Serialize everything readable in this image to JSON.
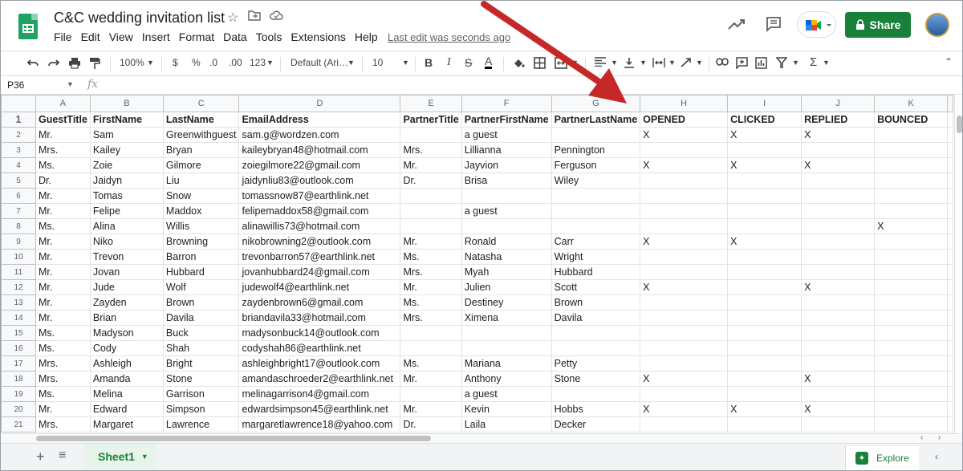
{
  "app": {
    "doc_title": "C&C wedding invitation list",
    "menu": [
      "File",
      "Edit",
      "View",
      "Insert",
      "Format",
      "Data",
      "Tools",
      "Extensions",
      "Help"
    ],
    "last_edit": "Last edit was seconds ago",
    "share_label": "Share",
    "brand_green": "#188038"
  },
  "toolbar": {
    "zoom": "100%",
    "currency": "$",
    "percent": "%",
    "decrease_decimal": ".0",
    "increase_decimal": ".00",
    "more_formats": "123",
    "font": "Default (Ari…",
    "font_size": "10",
    "bold": "B",
    "italic": "I",
    "strike": "S",
    "text_color": "A"
  },
  "formula_bar": {
    "cell_ref": "P36",
    "fx": "fx"
  },
  "sheet": {
    "columns": [
      "A",
      "B",
      "C",
      "D",
      "E",
      "F",
      "G",
      "H",
      "I",
      "J",
      "K"
    ],
    "rows": [
      [
        "GuestTitle",
        "FirstName",
        "LastName",
        "EmailAddress",
        "PartnerTitle",
        "PartnerFirstName",
        "PartnerLastName",
        "OPENED",
        "CLICKED",
        "REPLIED",
        "BOUNCED"
      ],
      [
        "Mr.",
        "Sam",
        "Greenwithguest",
        "sam.g@wordzen.com",
        "",
        "a guest",
        "",
        "X",
        "X",
        "X",
        ""
      ],
      [
        "Mrs.",
        "Kailey",
        "Bryan",
        "kaileybryan48@hotmail.com",
        "Mrs.",
        "Lillianna",
        "Pennington",
        "",
        "",
        "",
        ""
      ],
      [
        "Ms.",
        "Zoie",
        "Gilmore",
        "zoiegilmore22@gmail.com",
        "Mr.",
        "Jayvion",
        "Ferguson",
        "X",
        "X",
        "X",
        ""
      ],
      [
        "Dr.",
        "Jaidyn",
        "Liu",
        "jaidynliu83@outlook.com",
        "Dr.",
        "Brisa",
        "Wiley",
        "",
        "",
        "",
        ""
      ],
      [
        "Mr.",
        "Tomas",
        "Snow",
        "tomassnow87@earthlink.net",
        "",
        "",
        "",
        "",
        "",
        "",
        ""
      ],
      [
        "Mr.",
        "Felipe",
        "Maddox",
        "felipemaddox58@gmail.com",
        "",
        "a guest",
        "",
        "",
        "",
        "",
        ""
      ],
      [
        "Ms.",
        "Alina",
        "Willis",
        "alinawillis73@hotmail.com",
        "",
        "",
        "",
        "",
        "",
        "",
        "X"
      ],
      [
        "Mr.",
        "Niko",
        "Browning",
        "nikobrowning2@outlook.com",
        "Mr.",
        "Ronald",
        "Carr",
        "X",
        "X",
        "",
        ""
      ],
      [
        "Mr.",
        "Trevon",
        "Barron",
        "trevonbarron57@earthlink.net",
        "Ms.",
        "Natasha",
        "Wright",
        "",
        "",
        "",
        ""
      ],
      [
        "Mr.",
        "Jovan",
        "Hubbard",
        "jovanhubbard24@gmail.com",
        "Mrs.",
        "Myah",
        "Hubbard",
        "",
        "",
        "",
        ""
      ],
      [
        "Mr.",
        "Jude",
        "Wolf",
        "judewolf4@earthlink.net",
        "Mr.",
        "Julien",
        "Scott",
        "X",
        "",
        "X",
        ""
      ],
      [
        "Mr.",
        "Zayden",
        "Brown",
        "zaydenbrown6@gmail.com",
        "Ms.",
        "Destiney",
        "Brown",
        "",
        "",
        "",
        ""
      ],
      [
        "Mr.",
        "Brian",
        "Davila",
        "briandavila33@hotmail.com",
        "Mrs.",
        "Ximena",
        "Davila",
        "",
        "",
        "",
        ""
      ],
      [
        "Ms.",
        "Madyson",
        "Buck",
        "madysonbuck14@outlook.com",
        "",
        "",
        "",
        "",
        "",
        "",
        ""
      ],
      [
        "Ms.",
        "Cody",
        "Shah",
        "codyshah86@earthlink.net",
        "",
        "",
        "",
        "",
        "",
        "",
        ""
      ],
      [
        "Mrs.",
        "Ashleigh",
        "Bright",
        "ashleighbright17@outlook.com",
        "Ms.",
        "Mariana",
        "Petty",
        "",
        "",
        "",
        ""
      ],
      [
        "Mrs.",
        "Amanda",
        "Stone",
        "amandaschroeder2@earthlink.net",
        "Mr.",
        "Anthony",
        "Stone",
        "X",
        "",
        "X",
        ""
      ],
      [
        "Ms.",
        "Melina",
        "Garrison",
        "melinagarrison4@gmail.com",
        "",
        "a guest",
        "",
        "",
        "",
        "",
        ""
      ],
      [
        "Mr.",
        "Edward",
        "Simpson",
        "edwardsimpson45@earthlink.net",
        "Mr.",
        "Kevin",
        "Hobbs",
        "X",
        "X",
        "X",
        ""
      ],
      [
        "Mrs.",
        "Margaret",
        "Lawrence",
        "margaretlawrence18@yahoo.com",
        "Dr.",
        "Laila",
        "Decker",
        "",
        "",
        "",
        ""
      ]
    ]
  },
  "bottom": {
    "add": "+",
    "all_sheets": "≡",
    "sheet_name": "Sheet1",
    "explore": "Explore"
  },
  "annotation": {
    "arrow_color": "#c62828"
  }
}
